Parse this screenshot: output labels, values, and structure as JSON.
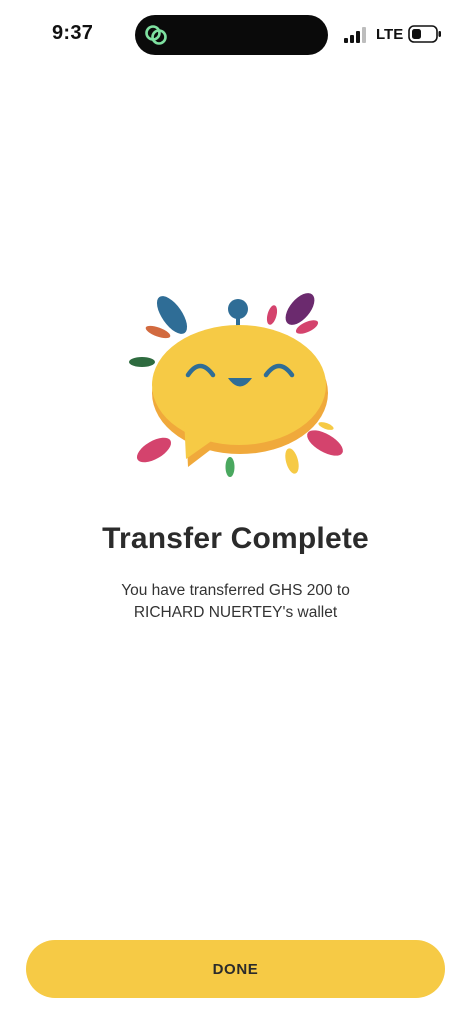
{
  "status_bar": {
    "time": "9:37",
    "network": "LTE",
    "icons": [
      "linked-rings-icon",
      "signal-bars-icon",
      "battery-icon"
    ]
  },
  "main": {
    "illustration": "smiling-chat-bubble-icon",
    "title": "Transfer Complete",
    "message_line1": "You have transferred GHS 200 to",
    "message_line2": "RICHARD NUERTEY's wallet"
  },
  "footer": {
    "done_label": "DONE"
  },
  "colors": {
    "accent": "#f6ca45",
    "text": "#2b2b2b",
    "island_icon": "#7ee0a0"
  }
}
